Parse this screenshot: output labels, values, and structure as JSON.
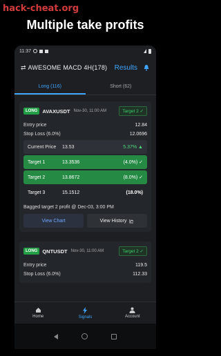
{
  "watermark": "hack-cheat.org",
  "headline": "Multiple take profits",
  "status": {
    "time": "11:37"
  },
  "appbar": {
    "title": "AWESOME MACD 4H(178)",
    "results": "Results"
  },
  "tabs": [
    {
      "label": "Long (116)",
      "active": true
    },
    {
      "label": "Short (62)",
      "active": false
    }
  ],
  "card1": {
    "badge": "LONG",
    "symbol": "AVAXUSDT",
    "date": "Nov-30, 11:00 AM",
    "target_badge": "Target 2 ✓",
    "entry_label": "Entry price",
    "entry_value": "12.84",
    "sl_label": "Stop Loss (6.0%)",
    "sl_value": "12.0696",
    "current_label": "Current Price",
    "current_value": "13.53",
    "current_pct": "5.37% ▲",
    "targets": [
      {
        "label": "Target 1",
        "price": "13.3536",
        "pct": "(4.0%) ✓"
      },
      {
        "label": "Target 2",
        "price": "13.8672",
        "pct": "(8.0%) ✓"
      },
      {
        "label": "Target 3",
        "price": "15.1512",
        "pct": "(18.0%)"
      }
    ],
    "bagged": "Bagged target 2 profit @ Dec-03, 3:00 PM",
    "view_chart": "View Chart",
    "view_history": "View History"
  },
  "card2": {
    "badge": "LONG",
    "symbol": "QNTUSDT",
    "date": "Nov-30, 11:00 AM",
    "target_badge": "Target 2 ✓",
    "entry_label": "Entry price",
    "entry_value": "119.5",
    "sl_label": "Stop Loss (6.0%)",
    "sl_value": "112.33"
  },
  "nav": {
    "home": "Home",
    "signals": "Signals",
    "account": "Account"
  },
  "colors": {
    "accent": "#3fa6ff",
    "green": "#258a43",
    "bg": "#1d1f23"
  }
}
